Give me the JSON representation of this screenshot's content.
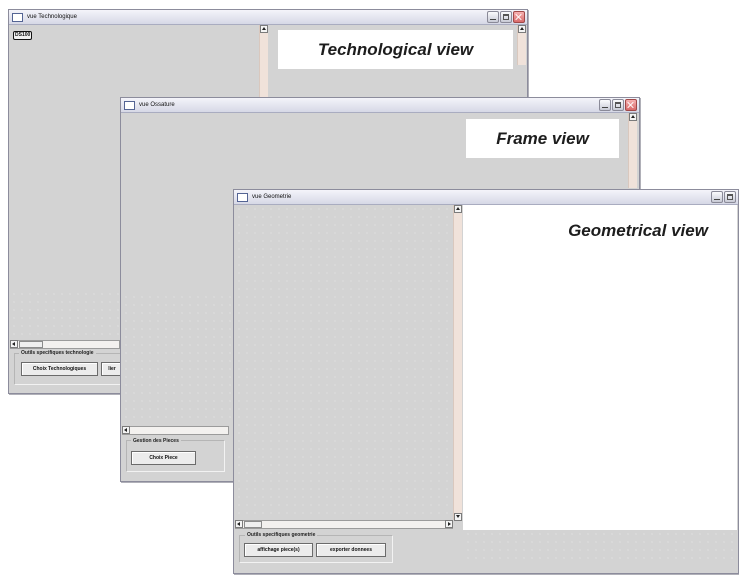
{
  "windows": {
    "technologique": {
      "title": "vue Technologique",
      "caption": "Technological view",
      "tag": "DS100",
      "group_label": "Outils specifiques technologie",
      "buttons": [
        "Choix Technologiques",
        "lier"
      ]
    },
    "ossature": {
      "title": "vue Ossature",
      "caption": "Frame view",
      "group_label": "Gestion des Pieces",
      "buttons": [
        "Choix Piece"
      ]
    },
    "geometrie": {
      "title": "vue Geometrie",
      "caption": "Geometrical view",
      "group_label": "Outils specifiques geometrie",
      "buttons": [
        "affichage piece(s)",
        "exporter donnees"
      ]
    }
  },
  "icons": [
    "window-icon",
    "minimize-icon",
    "maximize-icon",
    "close-icon",
    "scroll-up-icon",
    "scroll-down-icon",
    "scroll-left-icon",
    "scroll-right-icon"
  ]
}
